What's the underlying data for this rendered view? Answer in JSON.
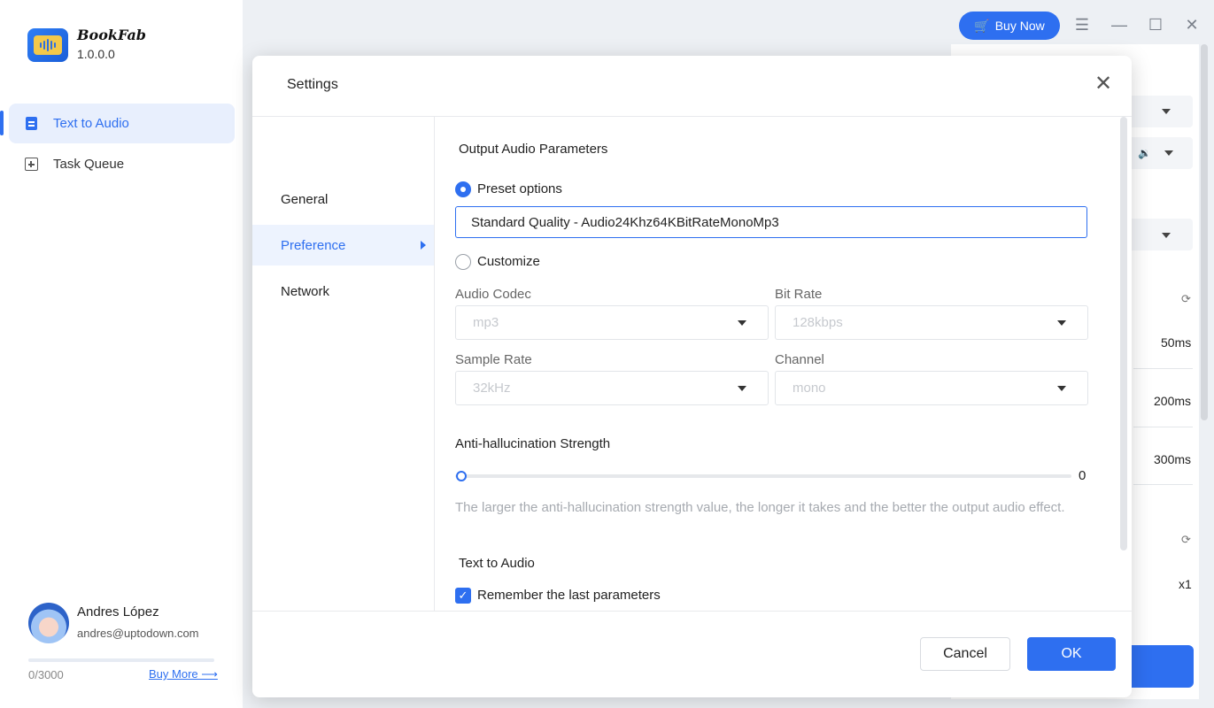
{
  "app": {
    "name": "BookFab",
    "version": "1.0.0.0"
  },
  "sidebar": {
    "items": [
      {
        "label": "Text to Audio",
        "icon": "document-icon",
        "active": true
      },
      {
        "label": "Task Queue",
        "icon": "queue-icon",
        "active": false
      }
    ],
    "user": {
      "name": "Andres López",
      "email": "andres@uptodown.com",
      "quota_text": "0/3000",
      "quota_progress": 0,
      "buy_more_label": "Buy More ⟶"
    }
  },
  "topbar": {
    "buy_now_label": "Buy Now",
    "cart_icon": "🛒",
    "menu_icon": "☰",
    "minimize_icon": "—",
    "maximize_icon": "☐",
    "close_icon": "✕"
  },
  "background_panel": {
    "values": [
      "50ms",
      "200ms",
      "300ms",
      "x1"
    ],
    "speaker_icon": "🔉",
    "refresh_icon": "⟳"
  },
  "settings": {
    "title": "Settings",
    "close_icon": "✕",
    "nav": [
      {
        "label": "General",
        "active": false
      },
      {
        "label": "Preference",
        "active": true
      },
      {
        "label": "Network",
        "active": false
      }
    ],
    "output_audio_title": "Output Audio Parameters",
    "preset_label": "Preset options",
    "preset_value": "Standard Quality - Audio24Khz64KBitRateMonoMp3",
    "customize_label": "Customize",
    "audio_codec_label": "Audio Codec",
    "audio_codec_value": "mp3",
    "bit_rate_label": "Bit Rate",
    "bit_rate_value": "128kbps",
    "sample_rate_label": "Sample Rate",
    "sample_rate_value": "32kHz",
    "channel_label": "Channel",
    "channel_value": "mono",
    "anti_hallucination_label": "Anti-hallucination Strength",
    "anti_hallucination_value": "0",
    "anti_hallucination_hint": "The larger the anti-hallucination strength value, the longer it takes and the better the output audio effect.",
    "text_to_audio_title": "Text to Audio",
    "remember_label": "Remember the last parameters",
    "remember_checked": true,
    "cancel_label": "Cancel",
    "ok_label": "OK"
  },
  "colors": {
    "accent": "#2e6ff0",
    "background": "#edf0f4"
  }
}
